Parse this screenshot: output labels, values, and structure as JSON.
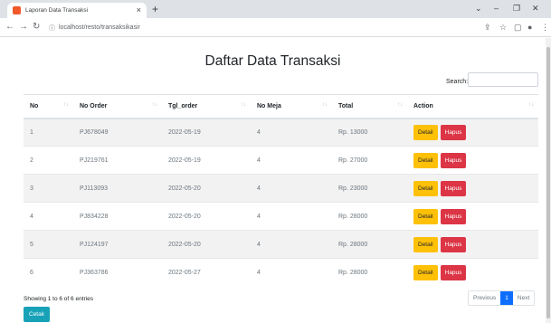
{
  "browser": {
    "tab_title": "Laporan Data Transaksi",
    "tab_close": "×",
    "new_tab": "+",
    "url": "localhost/resto/transaksikasir",
    "win_min": "⌄",
    "win_dash": "–",
    "win_restore": "❐",
    "win_close": "✕"
  },
  "page": {
    "title": "Daftar Data Transaksi",
    "search_label": "Search:",
    "search_value": ""
  },
  "table": {
    "columns": [
      "No",
      "No Order",
      "Tgl_order",
      "No Meja",
      "Total",
      "Action"
    ],
    "rows": [
      {
        "no": "1",
        "order": "PJ678049",
        "tgl": "2022-05-19",
        "meja": "4",
        "total": "Rp. 13000"
      },
      {
        "no": "2",
        "order": "PJ219761",
        "tgl": "2022-05-19",
        "meja": "4",
        "total": "Rp. 27000"
      },
      {
        "no": "3",
        "order": "PJ113093",
        "tgl": "2022-05-20",
        "meja": "4",
        "total": "Rp. 23000"
      },
      {
        "no": "4",
        "order": "PJ834228",
        "tgl": "2022-05-20",
        "meja": "4",
        "total": "Rp. 28000"
      },
      {
        "no": "5",
        "order": "PJ124197",
        "tgl": "2022-05-20",
        "meja": "4",
        "total": "Rp. 28000"
      },
      {
        "no": "6",
        "order": "PJ363786",
        "tgl": "2022-05-27",
        "meja": "4",
        "total": "Rp. 28000"
      }
    ],
    "detail_label": "Detail",
    "hapus_label": "Hapus"
  },
  "footer": {
    "info": "Showing 1 to 6 of 6 entries",
    "prev": "Previous",
    "page": "1",
    "next": "Next",
    "cetak": "Cetak"
  }
}
